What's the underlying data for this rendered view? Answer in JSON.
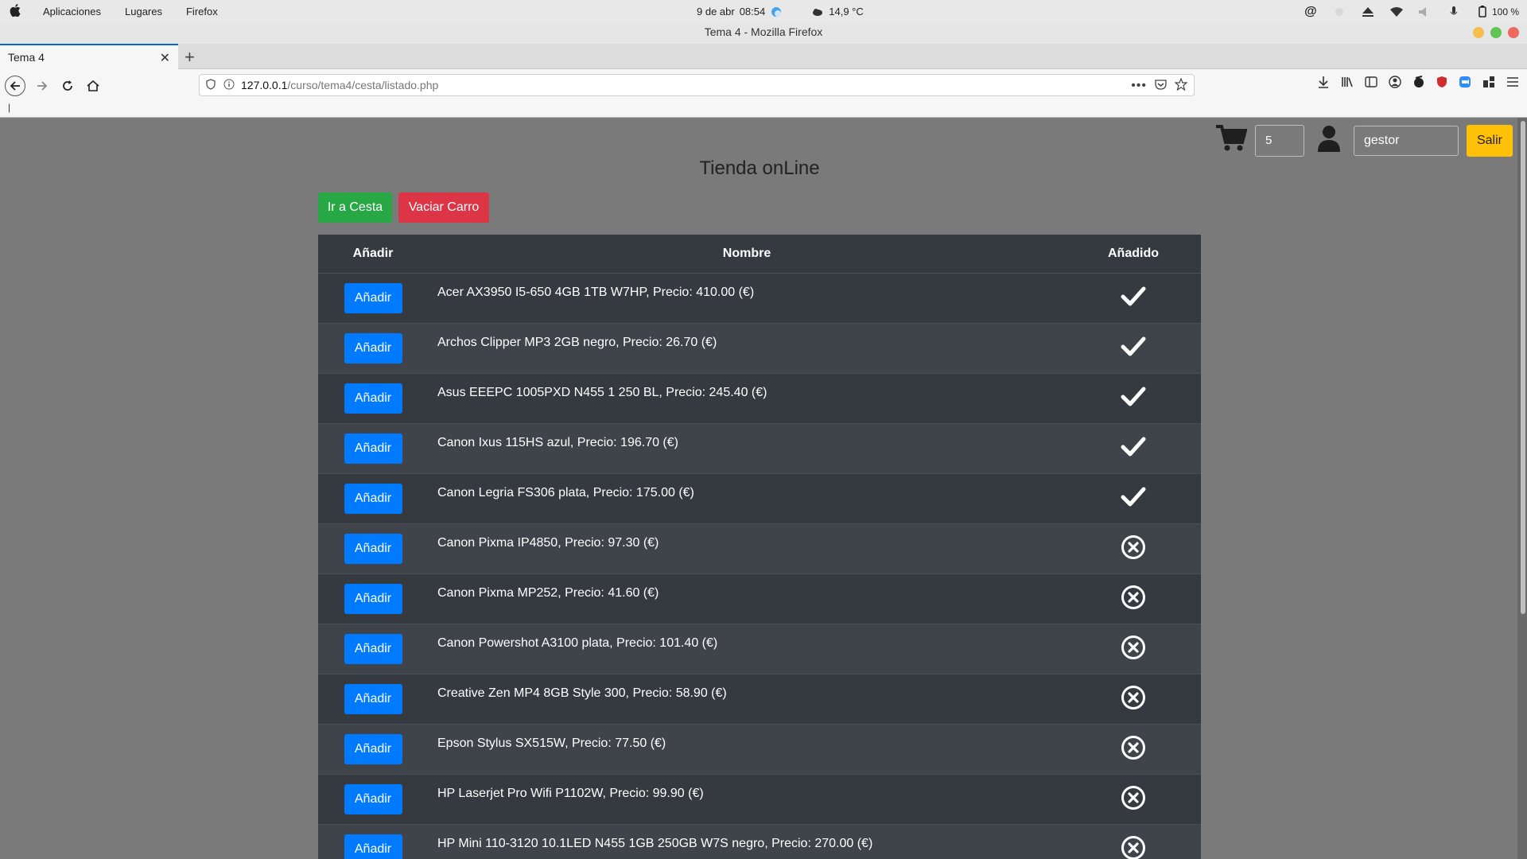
{
  "os": {
    "menus": [
      "Aplicaciones",
      "Lugares",
      "Firefox"
    ],
    "date": "9 de abr",
    "time": "08:54",
    "weather": "14,9 °C",
    "battery": "100 %"
  },
  "window": {
    "title": "Tema 4 - Mozilla Firefox"
  },
  "tab": {
    "label": "Tema 4"
  },
  "url": {
    "host": "127.0.0.1",
    "path": "/curso/tema4/cesta/listado.php"
  },
  "bookmarks": {
    "text": "|"
  },
  "page": {
    "title": "Tienda onLine",
    "cart_count": "5",
    "user": "gestor",
    "logout_label": "Salir",
    "go_cart_label": "Ir a Cesta",
    "empty_cart_label": "Vaciar Carro",
    "table": {
      "headers": [
        "Añadir",
        "Nombre",
        "Añadido"
      ],
      "add_label": "Añadir",
      "rows": [
        {
          "name": "Acer AX3950 I5-650 4GB 1TB W7HP, Precio: 410.00 (€)",
          "added": true
        },
        {
          "name": "Archos Clipper MP3 2GB negro, Precio: 26.70 (€)",
          "added": true
        },
        {
          "name": "Asus EEEPC 1005PXD N455 1 250 BL, Precio: 245.40 (€)",
          "added": true
        },
        {
          "name": "Canon Ixus 115HS azul, Precio: 196.70 (€)",
          "added": true
        },
        {
          "name": "Canon Legria FS306 plata, Precio: 175.00 (€)",
          "added": true
        },
        {
          "name": "Canon Pixma IP4850, Precio: 97.30 (€)",
          "added": false
        },
        {
          "name": "Canon Pixma MP252, Precio: 41.60 (€)",
          "added": false
        },
        {
          "name": "Canon Powershot A3100 plata, Precio: 101.40 (€)",
          "added": false
        },
        {
          "name": "Creative Zen MP4 8GB Style 300, Precio: 58.90 (€)",
          "added": false
        },
        {
          "name": "Epson Stylus SX515W, Precio: 77.50 (€)",
          "added": false
        },
        {
          "name": "HP Laserjet Pro Wifi P1102W, Precio: 99.90 (€)",
          "added": false
        },
        {
          "name": "HP Mini 110-3120 10.1LED N455 1GB 250GB W7S negro, Precio: 270.00 (€)",
          "added": false
        }
      ]
    }
  },
  "colors": {
    "added_yes": "check-icon",
    "added_no": "x-circle-icon",
    "primary": "#007bff",
    "success": "#28a745",
    "danger": "#dc3545",
    "warning": "#fec107"
  }
}
